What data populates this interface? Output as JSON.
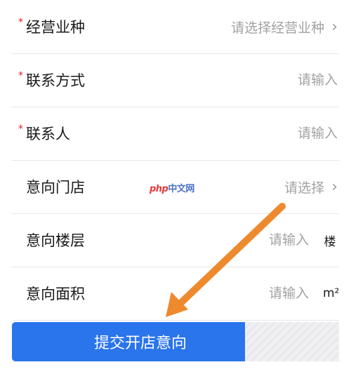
{
  "form": {
    "rows": [
      {
        "label": "经营业种",
        "required": true,
        "type": "select",
        "value": "请选择经营业种"
      },
      {
        "label": "联系方式",
        "required": true,
        "type": "input",
        "placeholder": "请输入"
      },
      {
        "label": "联系人",
        "required": true,
        "type": "input",
        "placeholder": "请输入"
      },
      {
        "label": "意向门店",
        "required": false,
        "type": "select",
        "value": "请选择"
      },
      {
        "label": "意向楼层",
        "required": false,
        "type": "input",
        "placeholder": "请输入",
        "unit": "楼"
      },
      {
        "label": "意向面积",
        "required": false,
        "type": "input",
        "placeholder": "请输入",
        "unit": "m²"
      }
    ],
    "required_mark": "*",
    "chevron": "›"
  },
  "submit_label": "提交开店意向",
  "watermark": {
    "prefix": "php",
    "text": "中文网"
  },
  "colors": {
    "primary": "#2a74ec",
    "required": "#e02020",
    "placeholder": "#a2a2a2",
    "annotation": "#ee8a2e"
  },
  "icons": {
    "select_chevron": "chevron-right-icon",
    "annotation": "arrow-icon"
  }
}
